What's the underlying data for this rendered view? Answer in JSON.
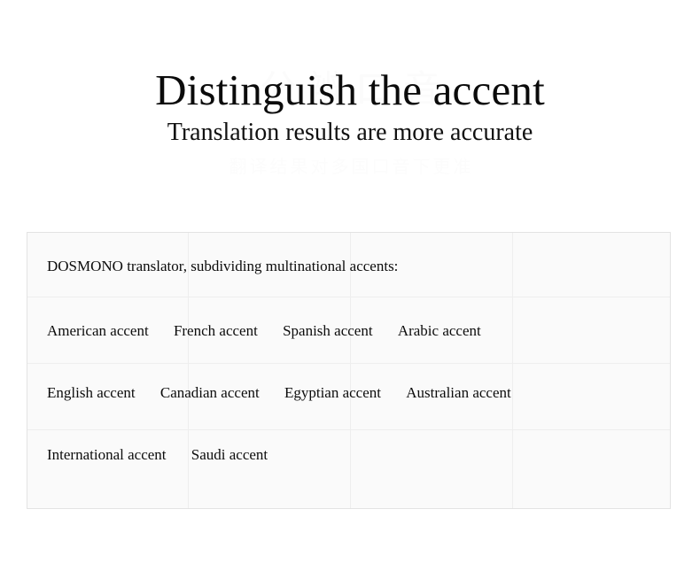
{
  "header": {
    "title": "Distinguish the accent",
    "subtitle": "Translation results are more accurate",
    "ghost_title": "分辨口音",
    "ghost_subtitle": "翻译结果对多国口音下更准"
  },
  "panel": {
    "heading": "DOSMONO translator, subdividing multinational accents:",
    "rows": [
      {
        "items": [
          {
            "label": "American accent"
          },
          {
            "label": "French accent"
          },
          {
            "label": "Spanish accent"
          },
          {
            "label": "Arabic accent"
          }
        ]
      },
      {
        "items": [
          {
            "label": "English accent"
          },
          {
            "label": "Canadian accent"
          },
          {
            "label": "Egyptian accent"
          },
          {
            "label": "Australian accent"
          }
        ]
      },
      {
        "items": [
          {
            "label": "International accent"
          },
          {
            "label": "Saudi accent"
          }
        ]
      }
    ]
  },
  "colors": {
    "page_background": "#ffffff",
    "panel_background": "#fafafa",
    "panel_border": "#e3e3e3",
    "grid_line": "#eeeeee",
    "text": "#0c0c0c",
    "ghost_text": "#fbfbfb"
  }
}
